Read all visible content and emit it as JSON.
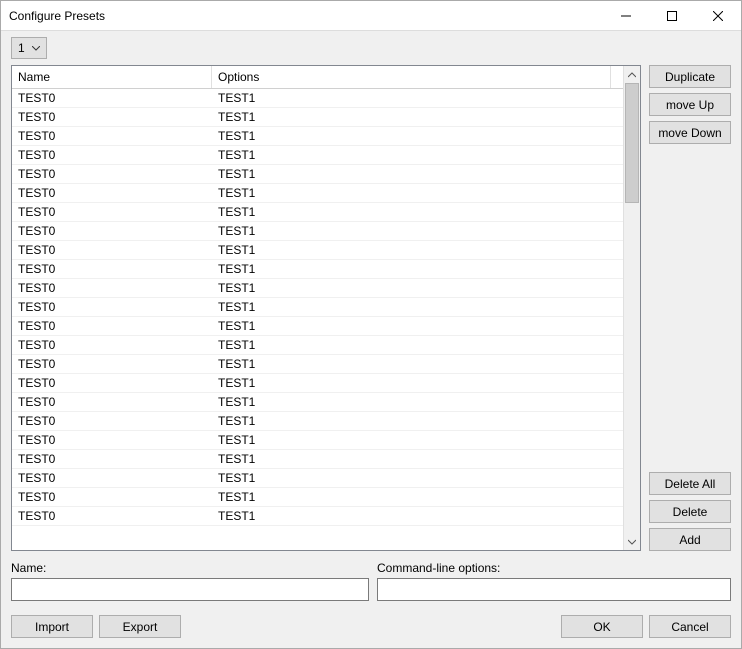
{
  "window": {
    "title": "Configure Presets"
  },
  "combo": {
    "value": "1"
  },
  "table": {
    "headers": {
      "name": "Name",
      "options": "Options"
    },
    "rows": [
      {
        "name": "TEST0",
        "options": "TEST1"
      },
      {
        "name": "TEST0",
        "options": "TEST1"
      },
      {
        "name": "TEST0",
        "options": "TEST1"
      },
      {
        "name": "TEST0",
        "options": "TEST1"
      },
      {
        "name": "TEST0",
        "options": "TEST1"
      },
      {
        "name": "TEST0",
        "options": "TEST1"
      },
      {
        "name": "TEST0",
        "options": "TEST1"
      },
      {
        "name": "TEST0",
        "options": "TEST1"
      },
      {
        "name": "TEST0",
        "options": "TEST1"
      },
      {
        "name": "TEST0",
        "options": "TEST1"
      },
      {
        "name": "TEST0",
        "options": "TEST1"
      },
      {
        "name": "TEST0",
        "options": "TEST1"
      },
      {
        "name": "TEST0",
        "options": "TEST1"
      },
      {
        "name": "TEST0",
        "options": "TEST1"
      },
      {
        "name": "TEST0",
        "options": "TEST1"
      },
      {
        "name": "TEST0",
        "options": "TEST1"
      },
      {
        "name": "TEST0",
        "options": "TEST1"
      },
      {
        "name": "TEST0",
        "options": "TEST1"
      },
      {
        "name": "TEST0",
        "options": "TEST1"
      },
      {
        "name": "TEST0",
        "options": "TEST1"
      },
      {
        "name": "TEST0",
        "options": "TEST1"
      },
      {
        "name": "TEST0",
        "options": "TEST1"
      },
      {
        "name": "TEST0",
        "options": "TEST1"
      }
    ]
  },
  "buttons": {
    "duplicate": "Duplicate",
    "move_up": "move Up",
    "move_down": "move Down",
    "delete_all": "Delete All",
    "delete": "Delete",
    "add": "Add",
    "import": "Import",
    "export": "Export",
    "ok": "OK",
    "cancel": "Cancel"
  },
  "form": {
    "name_label": "Name:",
    "options_label": "Command-line options:",
    "name_value": "",
    "options_value": ""
  }
}
